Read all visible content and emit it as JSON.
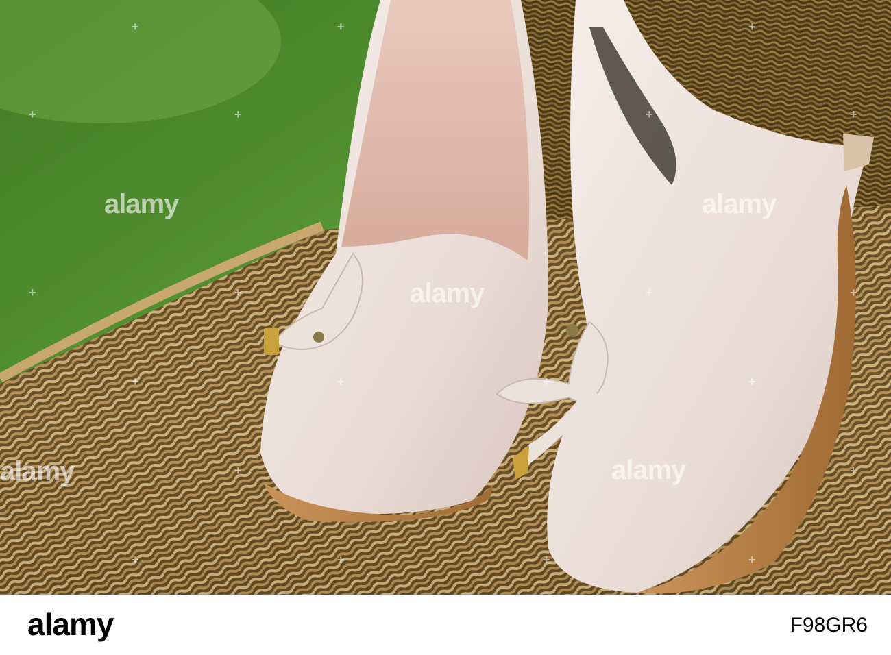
{
  "image": {
    "subject": "pair of white leather shoes on wicker chair",
    "colors": {
      "grass": "#4f8a2e",
      "wicker": "#a88650",
      "shoe": "#efe6e1",
      "footer_bg": "#ffffff"
    }
  },
  "watermark": {
    "text": "alamy",
    "tick_glyph": "+"
  },
  "footer": {
    "logo": "alamy",
    "image_id": "F98GR6"
  }
}
